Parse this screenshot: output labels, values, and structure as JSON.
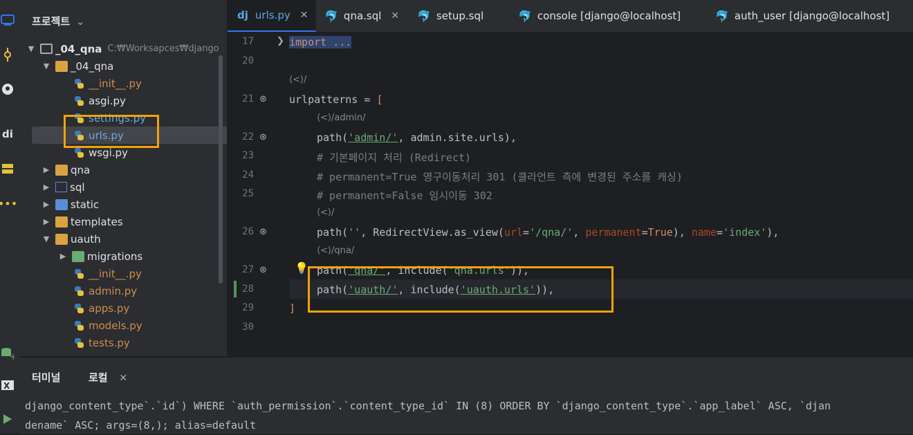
{
  "project_panel": {
    "title": "프로젝트",
    "title_chevron": "⌄",
    "root": {
      "name": "_04_qna",
      "path": "C:₩Worksapces₩django"
    },
    "items": [
      {
        "label": "_04_qna",
        "kind": "folder"
      },
      {
        "label": "__init__.py",
        "kind": "py"
      },
      {
        "label": "asgi.py",
        "kind": "py"
      },
      {
        "label": "settings.py",
        "kind": "py"
      },
      {
        "label": "urls.py",
        "kind": "py"
      },
      {
        "label": "wsgi.py",
        "kind": "py"
      },
      {
        "label": "qna",
        "kind": "folder"
      },
      {
        "label": "sql",
        "kind": "folder"
      },
      {
        "label": "static",
        "kind": "folder"
      },
      {
        "label": "templates",
        "kind": "folder"
      },
      {
        "label": "uauth",
        "kind": "folder"
      },
      {
        "label": "migrations",
        "kind": "folder"
      },
      {
        "label": "__init__.py",
        "kind": "py"
      },
      {
        "label": "admin.py",
        "kind": "py"
      },
      {
        "label": "apps.py",
        "kind": "py"
      },
      {
        "label": "models.py",
        "kind": "py"
      },
      {
        "label": "tests.py",
        "kind": "py"
      }
    ]
  },
  "tabs": [
    {
      "label": "urls.py",
      "active": true,
      "closable": true
    },
    {
      "label": "qna.sql",
      "active": false,
      "closable": true
    },
    {
      "label": "setup.sql",
      "active": false,
      "closable": false
    },
    {
      "label": "console [django@localhost]",
      "active": false,
      "closable": false
    },
    {
      "label": "auth_user [django@localhost]",
      "active": false,
      "closable": false
    }
  ],
  "editor": {
    "line_numbers": [
      "17",
      "20",
      "21",
      "22",
      "23",
      "24",
      "25",
      "26",
      "27",
      "28",
      "29",
      "30"
    ],
    "hints": [
      "/",
      "/admin/",
      "/",
      "/qna/"
    ],
    "code": {
      "l17": "import ...",
      "l21_a": "urlpatterns = ",
      "l21_b": "[",
      "l22_a": "path(",
      "l22_str": "'admin/'",
      "l22_b": ", admin.site.urls),",
      "l23": "# 기본페이지 처리 (Redirect)",
      "l24": "# permanent=True 영구이동처리 301 (클라언트 측에 변경된 주소를 캐싱)",
      "l25": "# permanent=False 임시이동 302",
      "l26_a": "path(",
      "l26_s1": "''",
      "l26_b": ", RedirectView.as_view(",
      "l26_p1": "url",
      "l26_eq1": "=",
      "l26_s2": "'/qna/'",
      "l26_c": ", ",
      "l26_p2": "permanent",
      "l26_eq2": "=",
      "l26_true": "True",
      "l26_d": "), ",
      "l26_p3": "name",
      "l26_eq3": "=",
      "l26_s3": "'index'",
      "l26_e": "),",
      "l27_a": "path(",
      "l27_s1": "'qna/'",
      "l27_b": ", include(",
      "l27_s2": "'qna.urls'",
      "l27_c": ")),",
      "l28_a": "path(",
      "l28_s1": "'uauth/'",
      "l28_b": ", include(",
      "l28_s2": "'uauth.urls'",
      "l28_c": ")),",
      "l29": "]"
    }
  },
  "bottom_panel": {
    "tabs": [
      {
        "label": "터미널",
        "active": false
      },
      {
        "label": "로컬",
        "active": true
      }
    ],
    "log_lines": [
      "django_content_type`.`id`) WHERE `auth_permission`.`content_type_id` IN (8) ORDER BY `django_content_type`.`app_label` ASC, `djan",
      "dename` ASC; args=(8,); alias=default"
    ]
  },
  "colors": {
    "accent": "#3574f0",
    "highlight_box": "#f0a30a",
    "string": "#6aab73",
    "keyword": "#cf8e6d",
    "param": "#aa4926"
  }
}
